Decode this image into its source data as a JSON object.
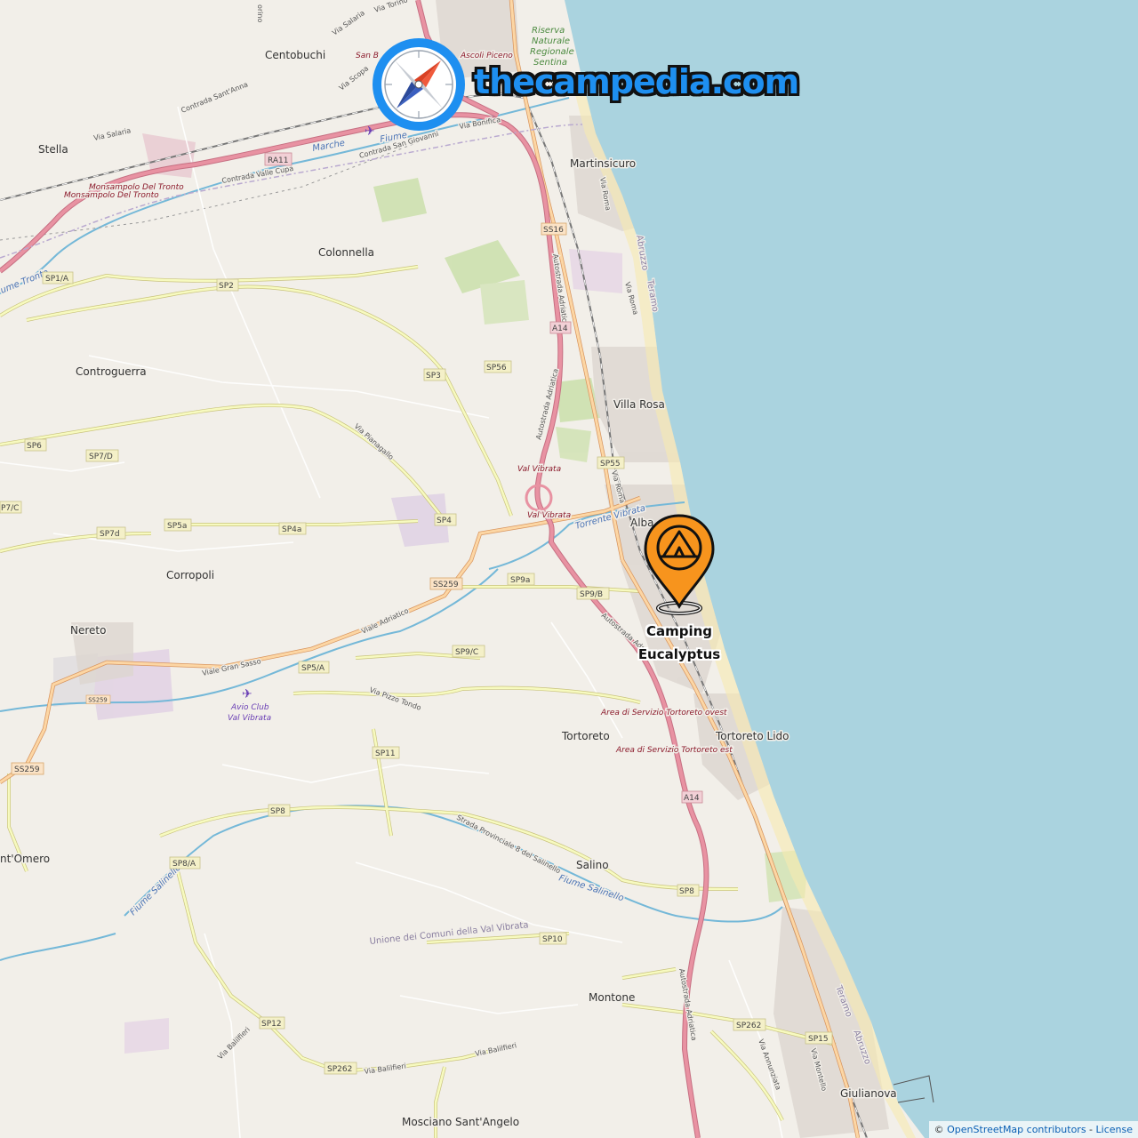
{
  "brand": {
    "text": "thecampedia.com",
    "logo_icon": "compass-icon"
  },
  "marker": {
    "icon": "camping-tent-icon",
    "label_line1": "Camping",
    "label_line2": "Eucalyptus",
    "color": "#f7941d"
  },
  "attribution": {
    "prefix": "© ",
    "osm": "OpenStreetMap contributors",
    "sep": " - ",
    "license": "License"
  },
  "colors": {
    "sea": "#aad3df",
    "land": "#f2efe9",
    "motorway": "#e892a2",
    "trunk": "#f9b29c",
    "secondary": "#f7fabf",
    "water": "#74b8d8"
  },
  "places": {
    "centobuchi": "Centobuchi",
    "stella": "Stella",
    "martinsicuro": "Martinsicuro",
    "colonnella": "Colonnella",
    "controguerra": "Controguerra",
    "villa_rosa": "Villa Rosa",
    "alba": "Alba",
    "corropoli": "Corropoli",
    "nereto": "Nereto",
    "tortoreto": "Tortoreto",
    "tortoreto_lido": "Tortoreto Lido",
    "salino": "Salino",
    "santomero": "nt'Omero",
    "montone": "Montone",
    "giulianova": "Giulianova",
    "mosciano": "Mosciano Sant'Angelo",
    "monsampolo1": "Monsampolo Del Tronto",
    "monsampolo2": "Monsampolo Del Tronto",
    "ascoli": "Ascoli Piceno",
    "san_b": "San B",
    "riserva": [
      "Riserva",
      "Naturale",
      "Regionale",
      "Sentina"
    ],
    "val_vibrata1": "Val Vibrata",
    "val_vibrata2": "Val Vibrata",
    "area_ovest": "Area di Servizio Tortoreto ovest",
    "area_est": "Area di Servizio Tortoreto est",
    "avio": [
      "Avio Club",
      "Val Vibrata"
    ],
    "unione": "Unione dei Comuni della Val Vibrata"
  },
  "water_labels": {
    "marche_fiume": "Marche",
    "fiume": "Fiume",
    "tronto": "ume Tronto",
    "torrente_vibrata": "Torrente Vibrata",
    "fiume_salinello1": "Fiume Salinello",
    "fiume_salinello2": "Fiume Salinello",
    "abruzzo1": "Abruzzo",
    "teramo1": "Teramo",
    "abruzzo2": "Abruzzo",
    "teramo2": "Teramo"
  },
  "streets": {
    "via_salaria1": "Via Salaria",
    "via_torino": "Via Torino",
    "via_scopa": "Via Scopa",
    "contrada_sant_anna": "Contrada Sant'Anna",
    "via_salaria2": "Via Salaria",
    "contrada_san_giovanni": "Contrada San Giovanni",
    "via_bonifica": "Via Bonifica",
    "contrada_valle_cupa": "Contrada Valle Cupa",
    "via_roma1": "Via Roma",
    "via_roma2": "Via Roma",
    "via_roma3": "Via Roma",
    "autostrada1": "Autostrada Adriatica",
    "autostrada2": "Autostrada Adriatica",
    "autostrada3": "Autostrada Adr",
    "autostrada4": "Autostrada Adriatica",
    "via_pianagallo": "Via Pianagallo",
    "viale_adriatico": "Viale Adriatico",
    "viale_gran_sasso": "Viale Gran Sasso",
    "via_pizzo_tondo": "Via Pizzo Tondo",
    "strada_salinello": "Strada Provinciale 8 del Salinello",
    "via_ballifieri1": "Via Balilfieri",
    "via_ballifieri2": "Via Balilfieri",
    "via_ballifieri3": "Via Balilfieri",
    "via_annunziata": "Via Annunziata",
    "via_montello": "Via Montello",
    "torino_frag": "orino"
  },
  "shields": {
    "ra11": "RA11",
    "ss16": "SS16",
    "a14a": "A14",
    "a14b": "A14",
    "sp1a": "SP1/A",
    "sp2": "SP2",
    "sp56": "SP56",
    "sp3": "SP3",
    "sp6": "SP6",
    "sp7d": "SP7/D",
    "sp7c": "P7/C",
    "sp7d2": "SP7d",
    "sp5a": "SP5a",
    "sp4a": "SP4a",
    "sp4": "SP4",
    "sp55": "SP55",
    "ss259a": "SS259",
    "sp9a": "SP9a",
    "sp9b": "SP9/B",
    "sp9c": "SP9/C",
    "sp5a2": "SP5/A",
    "ss259b": "SS259",
    "ss259c": "SS259",
    "sp11": "SP11",
    "sp8": "SP8",
    "sp8a": "SP8/A",
    "sp8b": "SP8",
    "sp10": "SP10",
    "sp12": "SP12",
    "sp262a": "SP262",
    "sp262b": "SP262",
    "sp15": "SP15"
  }
}
